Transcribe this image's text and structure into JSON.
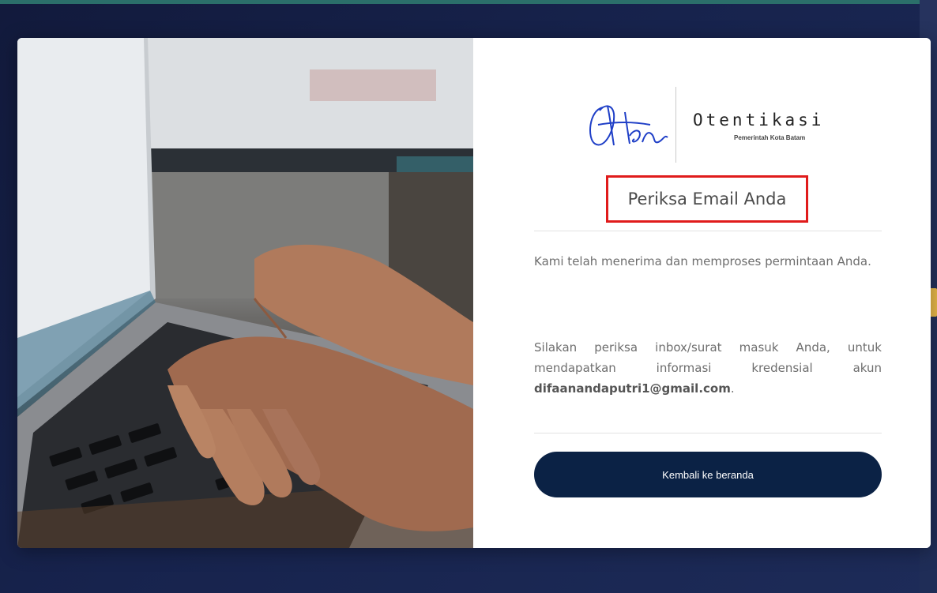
{
  "brand": {
    "signature_text": "Oten",
    "wordmark": "Otentikasi",
    "subtitle": "Pemerintah Kota Batam"
  },
  "page": {
    "title": "Periksa Email Anda",
    "message_1": "Kami telah menerima dan memproses permintaan Anda.",
    "message_2_prefix": "Silakan periksa inbox/surat masuk Anda, untuk mendapatkan informasi kredensial akun",
    "email": "difaanandaputri1@gmail.com",
    "message_2_suffix": "."
  },
  "actions": {
    "back_label": "Kembali ke beranda"
  },
  "colors": {
    "button_bg": "#0b2245",
    "highlight_border": "#e01b1b",
    "page_bg": "#17234d",
    "accent_tab": "#e8b84a"
  },
  "photo": {
    "subject": "hands typing on laptop keyboard"
  }
}
